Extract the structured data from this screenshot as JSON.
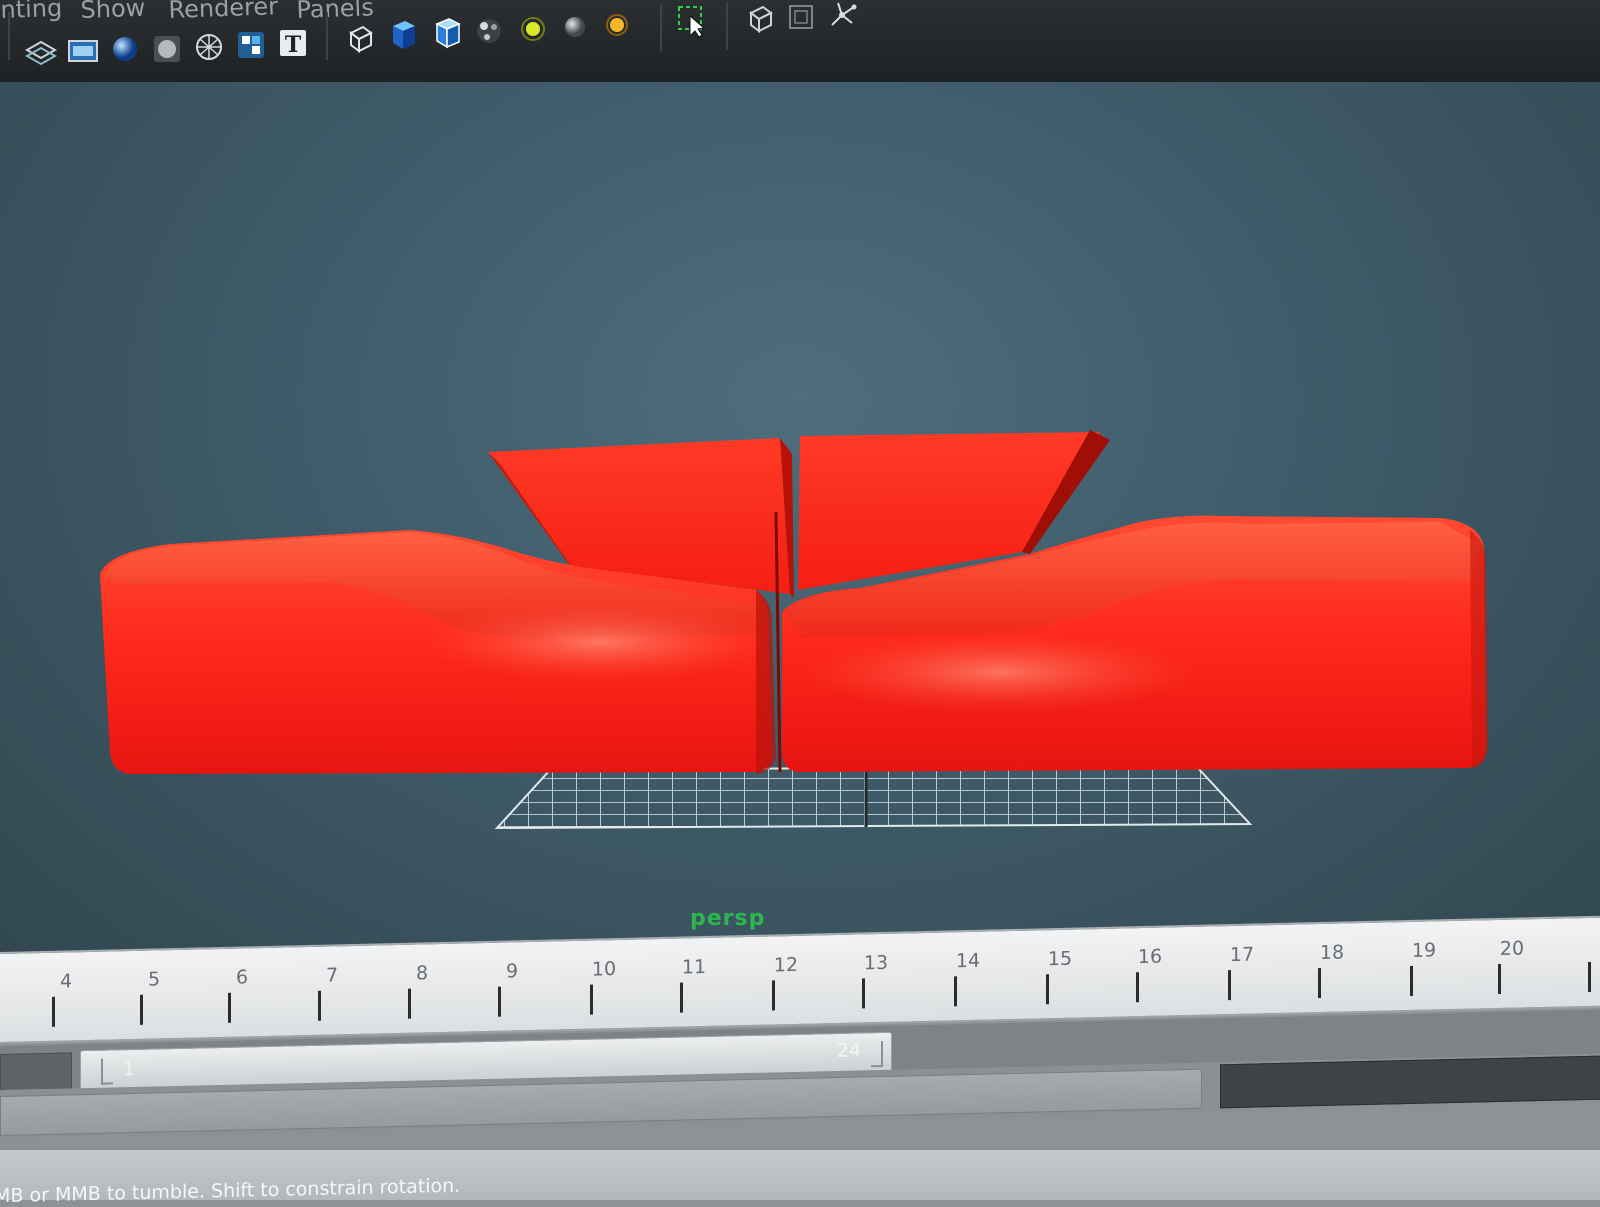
{
  "menu": {
    "items": [
      "nting",
      "Show",
      "Renderer",
      "Panels"
    ]
  },
  "viewport": {
    "camera_label": "persp"
  },
  "timeline": {
    "ticks": [
      "4",
      "5",
      "6",
      "7",
      "8",
      "9",
      "10",
      "11",
      "12",
      "13",
      "14",
      "15",
      "16",
      "17",
      "18",
      "19",
      "20"
    ]
  },
  "range": {
    "start": "1",
    "end": "24"
  },
  "help_line": {
    "text": "MB or MMB to tumble. Shift to constrain rotation."
  },
  "colors": {
    "model_red": "#ff2a1c",
    "viewport_bg": "#4a6775",
    "camera_label": "#2fb54f"
  }
}
